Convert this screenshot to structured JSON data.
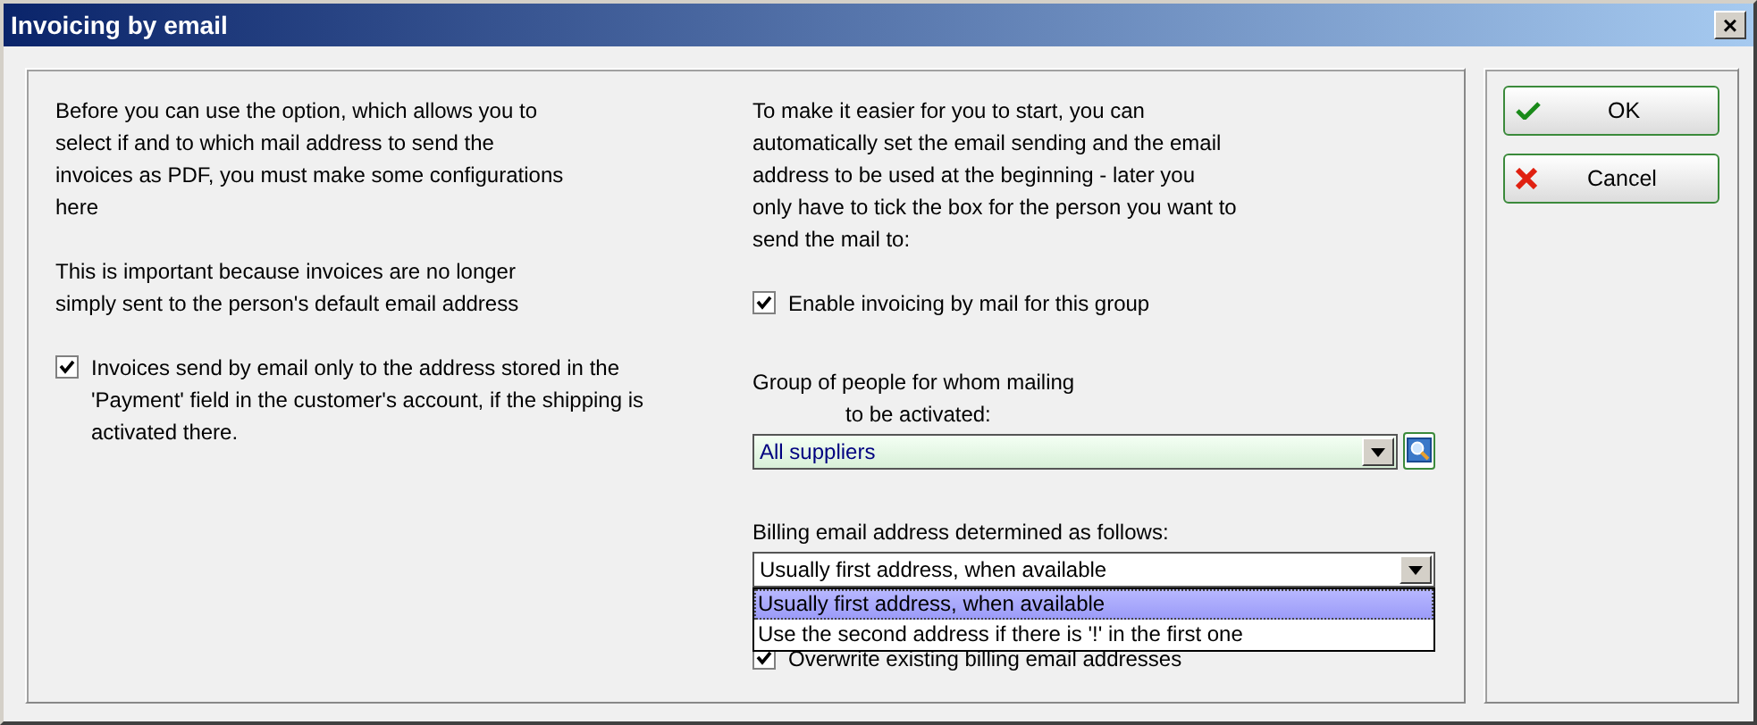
{
  "window": {
    "title": "Invoicing by email",
    "close": "×"
  },
  "left": {
    "paragraphs": [
      "Before you can use the option, which allows you to select if and to which mail address to send the invoices as PDF, you must make some configurations here",
      "This is important because invoices are no longer simply sent to the person's default email address"
    ],
    "checkbox": {
      "label": "Invoices send by email only to the address stored in the 'Payment' field in the customer's account, if the shipping is activated there.",
      "checked": true
    }
  },
  "right": {
    "intro": "To make it easier for you to start, you can automatically set the email sending and the email address to be used at the beginning - later you only have to tick the box for the person you want to send the mail to:",
    "enable": {
      "label": "Enable invoicing by mail for this group",
      "checked": true
    },
    "group_label_1": "Group of people for whom mailing",
    "group_label_2": "to be activated:",
    "group_select": {
      "value": "All suppliers"
    },
    "billing_label": "Billing email address determined as follows:",
    "billing_select": {
      "value": "Usually first address, when available",
      "expanded": true,
      "options": [
        {
          "label": "Usually first address, when available",
          "selected": true
        },
        {
          "label": "Use the second address if there is '!' in the first one",
          "selected": false
        }
      ]
    },
    "overwrite": {
      "label": "Overwrite existing billing email addresses",
      "checked": true
    }
  },
  "buttons": [
    {
      "kind": "ok",
      "label": "OK"
    },
    {
      "kind": "cancel",
      "label": "Cancel"
    }
  ]
}
